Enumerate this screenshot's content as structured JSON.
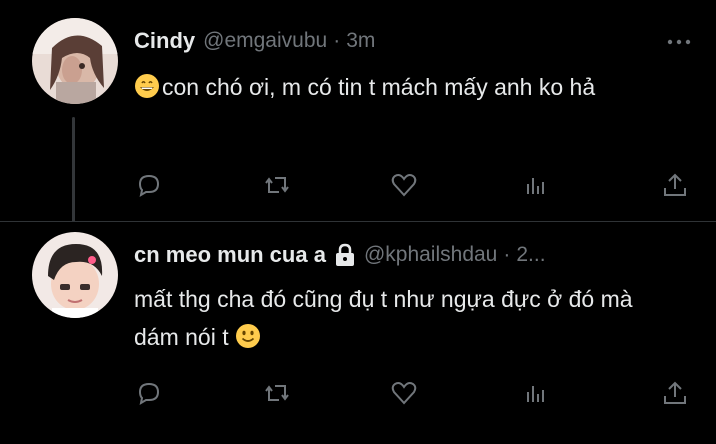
{
  "tweets": [
    {
      "name": "Cindy",
      "handle": "@emgaivubu",
      "dot": "·",
      "time": "3m",
      "text": "con chó ơi, m có tin t mách mấy anh ko hả",
      "emoji": "grinning-face",
      "protected": false
    },
    {
      "name": "cn meo mun cua a",
      "handle": "@kphailshdau",
      "dot": "·",
      "time": "2...",
      "text": "mất thg cha đó cũng đụ t như ngựa đực ở đó mà dám nói t",
      "emoji": "slightly-smiling-face",
      "protected": true
    }
  ],
  "icons": [
    "reply-icon",
    "retweet-icon",
    "like-icon",
    "views-icon",
    "share-icon",
    "more-icon",
    "lock-icon"
  ],
  "colors": {
    "background": "#000000",
    "text": "#e7e9ea",
    "secondary": "#71767b",
    "divider": "#2f3336"
  }
}
